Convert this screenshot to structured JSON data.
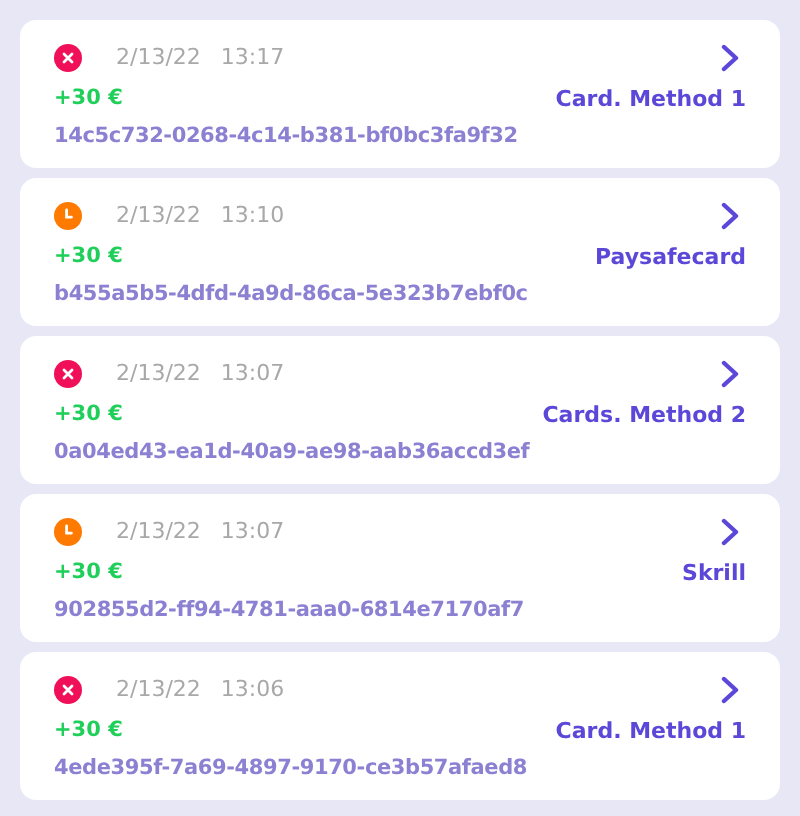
{
  "transactions": [
    {
      "kind": "failed",
      "date": "2/13/22",
      "time": "13:17",
      "amount": "+30 €",
      "method": "Card. Method 1",
      "id": "14c5c732-0268-4c14-b381-bf0bc3fa9f32"
    },
    {
      "kind": "pending",
      "date": "2/13/22",
      "time": "13:10",
      "amount": "+30 €",
      "method": "Paysafecard",
      "id": "b455a5b5-4dfd-4a9d-86ca-5e323b7ebf0c"
    },
    {
      "kind": "failed",
      "date": "2/13/22",
      "time": "13:07",
      "amount": "+30 €",
      "method": "Cards. Method 2",
      "id": "0a04ed43-ea1d-40a9-ae98-aab36accd3ef"
    },
    {
      "kind": "pending",
      "date": "2/13/22",
      "time": "13:07",
      "amount": "+30 €",
      "method": "Skrill",
      "id": "902855d2-ff94-4781-aaa0-6814e7170af7"
    },
    {
      "kind": "failed",
      "date": "2/13/22",
      "time": "13:06",
      "amount": "+30 €",
      "method": "Card. Method 1",
      "id": "4ede395f-7a69-4897-9170-ce3b57afaed8"
    }
  ]
}
